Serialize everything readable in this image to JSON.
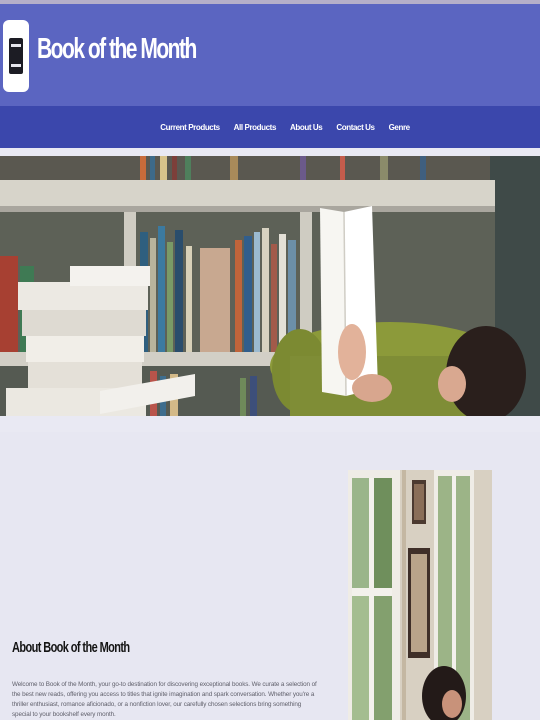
{
  "site": {
    "title": "Book of the Month"
  },
  "nav": {
    "items": [
      {
        "label": "Current Products"
      },
      {
        "label": "All Products"
      },
      {
        "label": "About Us"
      },
      {
        "label": "Contact Us"
      },
      {
        "label": "Genre"
      }
    ]
  },
  "about": {
    "heading": "About Book of the Month",
    "text": "Welcome to Book of the Month, your go-to destination for discovering exceptional books. We curate a selection of the best new reads, offering you access to titles that ignite imagination and spark conversation. Whether you're a thriller enthusiast, romance aficionado, or a nonfiction lover, our carefully chosen selections bring something special to your bookshelf every month."
  },
  "colors": {
    "header_bg": "#5b65c1",
    "nav_bg": "#3b47ac",
    "page_bg": "#e9e9f3"
  },
  "icons": {
    "logo": "book-logo-icon"
  }
}
